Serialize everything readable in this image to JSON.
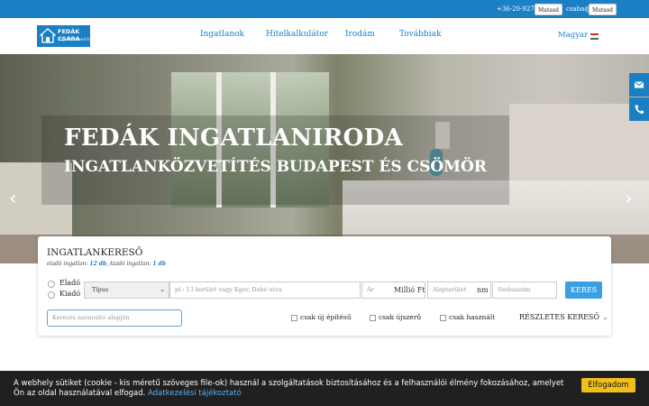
{
  "topbar": {
    "phone_prefix": "+36-20-927-",
    "phone_reveal": "Mutasd",
    "email_prefix": "csaba@",
    "email_reveal": "Mutasd"
  },
  "brand": {
    "name": "FEDÁK CSABA",
    "tagline": "ingatlanszakértő"
  },
  "nav": {
    "items": [
      "Ingatlanok",
      "Hitelkalkulátor",
      "Irodám",
      "Továbbiak"
    ],
    "language": "Magyar"
  },
  "hero": {
    "title": "FEDÁK INGATLANIRODA",
    "subtitle": "INGATLANKÖZVETÍTÉS BUDAPEST ÉS CSÖMÖR",
    "prev_icon": "chevron-left-icon",
    "next_icon": "chevron-right-icon"
  },
  "side_tabs": {
    "mail_icon": "envelope-icon",
    "phone_icon": "phone-icon"
  },
  "search": {
    "heading": "INGATLANKERESŐ",
    "counts_prefix": "eladó ingatlan: ",
    "counts_sale": "12 db",
    "counts_mid": ", kiadó ingatlan: ",
    "counts_rent": "1 db",
    "radio_sale": "Eladó",
    "radio_rent": "Kiadó",
    "type_select": "Típus",
    "location_placeholder": "pl.: 13 kerület vagy Eger, Dobó utca",
    "price_placeholder": "Ár",
    "price_unit": "Millió Ft",
    "area_placeholder": "Alapterület",
    "area_unit": "nm",
    "rooms_placeholder": "Szobaszám",
    "search_button": "KERES",
    "id_placeholder": "Keresés azonosító alapján",
    "check_new_build": "csak új építésű",
    "check_like_new": "csak újszerű",
    "check_used": "csak használt",
    "advanced": "RÉSZLETES KERESŐ"
  },
  "cookie": {
    "text_line1": "A webhely sütiket (cookie - kis méretű szöveges file-ok) használ a szolgáltatások biztosításához és a felhasználói élmény fokozásához, amelyet",
    "text_line2": "Ön az oldal használatával elfogad. ",
    "link": "Adatkezelési tájékoztató",
    "accept": "Elfogadom"
  },
  "colors": {
    "brand_blue": "#1b7fc4",
    "button_blue": "#3aa0e3",
    "cookie_bg": "#202020",
    "accept_yellow": "#f0c11a"
  }
}
